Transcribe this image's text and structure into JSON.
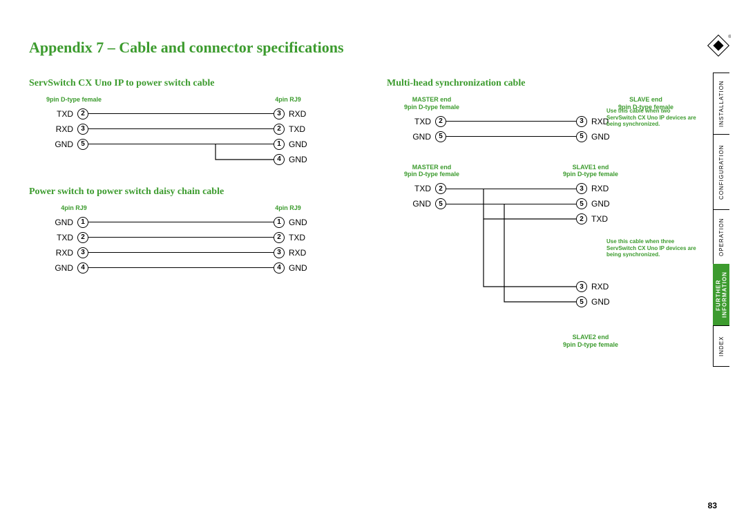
{
  "title": "Appendix 7 – Cable and connector specifications",
  "page_number": "83",
  "tabs": {
    "installation": "INSTALLATION",
    "configuration": "CONFIGURATION",
    "operation": "OPERATION",
    "further": "FURTHER\nINFORMATION",
    "index": "INDEX"
  },
  "cable1": {
    "title": "ServSwitch CX Uno IP to power switch cable",
    "left_header": "9pin D-type female",
    "right_header": "4pin RJ9",
    "rows": [
      {
        "ll": "TXD",
        "lp": "2",
        "rp": "3",
        "rl": "RXD"
      },
      {
        "ll": "RXD",
        "lp": "3",
        "rp": "2",
        "rl": "TXD"
      },
      {
        "ll": "GND",
        "lp": "5",
        "rp": "1",
        "rl": "GND"
      },
      {
        "ll": "",
        "lp": "",
        "rp": "4",
        "rl": "GND"
      }
    ]
  },
  "cable2": {
    "title": "Power switch to power switch daisy chain cable",
    "left_header": "4pin RJ9",
    "right_header": "4pin RJ9",
    "rows": [
      {
        "ll": "GND",
        "lp": "1",
        "rp": "1",
        "rl": "GND"
      },
      {
        "ll": "TXD",
        "lp": "2",
        "rp": "2",
        "rl": "TXD"
      },
      {
        "ll": "RXD",
        "lp": "3",
        "rp": "3",
        "rl": "RXD"
      },
      {
        "ll": "GND",
        "lp": "4",
        "rp": "4",
        "rl": "GND"
      }
    ]
  },
  "cable3": {
    "title": "Multi-head synchronization cable",
    "block1": {
      "left_header": "MASTER end\n9pin D-type female",
      "right_header": "SLAVE end\n9pin D-type female",
      "rows": [
        {
          "ll": "TXD",
          "lp": "2",
          "rp": "3",
          "rl": "RXD"
        },
        {
          "ll": "GND",
          "lp": "5",
          "rp": "5",
          "rl": "GND"
        }
      ],
      "note": "Use this cable when two ServSwitch CX Uno IP devices are being synchronized."
    },
    "block2": {
      "left_header": "MASTER end\n9pin D-type female",
      "right_header1": "SLAVE1 end\n9pin D-type female",
      "right_header2": "SLAVE2 end\n9pin D-type female",
      "rows_top": [
        {
          "ll": "TXD",
          "lp": "2",
          "rp": "3",
          "rl": "RXD"
        },
        {
          "ll": "GND",
          "lp": "5",
          "rp": "5",
          "rl": "GND"
        },
        {
          "ll": "",
          "lp": "",
          "rp": "2",
          "rl": "TXD"
        }
      ],
      "rows_bottom": [
        {
          "rp": "3",
          "rl": "RXD"
        },
        {
          "rp": "5",
          "rl": "GND"
        }
      ],
      "note": "Use this cable when three ServSwitch CX Uno IP devices are being synchronized."
    }
  }
}
